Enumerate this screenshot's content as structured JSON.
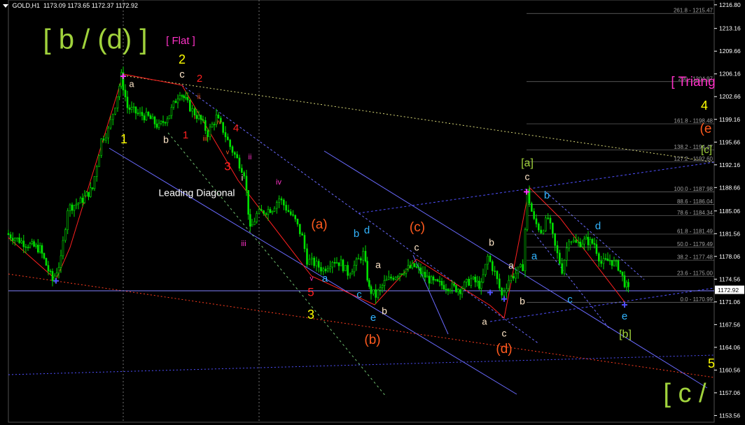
{
  "header": {
    "symbol": "GOLD,H1",
    "ohlc": "1173.09 1173.65 1172.37 1172.92"
  },
  "colors": {
    "background": "#000000",
    "candle": "#00e000",
    "axis": "#ffffff",
    "grid": "#707070",
    "fib": "#a0a0a0",
    "blue_line": "#3c3cff",
    "red_line": "#ff2020",
    "orange_label": "#ff5a1e",
    "yellow_label": "#ffff00",
    "green_label": "#a0d23c",
    "cyan_label": "#32b4ff",
    "magenta_label": "#ff32c8",
    "white_label": "#ffe6c8"
  },
  "chart_data": {
    "type": "candlestick",
    "symbol": "GOLD",
    "timeframe": "H1",
    "ylim": [
      1153.5,
      1217.0
    ],
    "y_ticks": [
      "1216.80",
      "1213.16",
      "1209.66",
      "1206.16",
      "1202.66",
      "1199.16",
      "1195.66",
      "1192.16",
      "1188.66",
      "1185.06",
      "1181.56",
      "1178.06",
      "1174.56",
      "1171.06",
      "1167.56",
      "1164.06",
      "1160.56",
      "1157.06",
      "1153.56"
    ],
    "current_price": "1172.92",
    "fib_levels": [
      {
        "label": "261.8 - 1215.47",
        "value": 1215.47
      },
      {
        "label": "200 - 1204.97",
        "value": 1204.97
      },
      {
        "label": "161.8 - 1198.48",
        "value": 1198.48
      },
      {
        "label": "138.2 - 1194.47",
        "value": 1194.47
      },
      {
        "label": "127.2 - 1192.60",
        "value": 1192.6
      },
      {
        "label": "100.0 - 1187.98",
        "value": 1187.98
      },
      {
        "label": "88.6 - 1186.04",
        "value": 1186.04
      },
      {
        "label": "78.6 - 1184.34",
        "value": 1184.34
      },
      {
        "label": "61.8 - 1181.49",
        "value": 1181.49
      },
      {
        "label": "50.0 - 1179.49",
        "value": 1179.49
      },
      {
        "label": "38.2 - 1177.48",
        "value": 1177.48
      },
      {
        "label": "23.6 - 1175.00",
        "value": 1175.0
      },
      {
        "label": "0.0 - 1170.99",
        "value": 1170.99
      }
    ],
    "price_path": [
      [
        12,
        1181.6
      ],
      [
        40,
        1180.0
      ],
      [
        60,
        1179.2
      ],
      [
        78,
        1174.3
      ],
      [
        90,
        1177.5
      ],
      [
        100,
        1185.5
      ],
      [
        118,
        1186.5
      ],
      [
        135,
        1188.5
      ],
      [
        148,
        1196.0
      ],
      [
        158,
        1197.5
      ],
      [
        168,
        1201.5
      ],
      [
        176,
        1205.8
      ],
      [
        185,
        1201.0
      ],
      [
        200,
        1200.0
      ],
      [
        215,
        1199.5
      ],
      [
        230,
        1198.0
      ],
      [
        245,
        1200.0
      ],
      [
        260,
        1203.5
      ],
      [
        268,
        1202.0
      ],
      [
        278,
        1200.5
      ],
      [
        290,
        1199.0
      ],
      [
        300,
        1197.0
      ],
      [
        312,
        1199.5
      ],
      [
        322,
        1197.5
      ],
      [
        332,
        1195.0
      ],
      [
        342,
        1193.0
      ],
      [
        352,
        1191.0
      ],
      [
        360,
        1182.0
      ],
      [
        370,
        1184.5
      ],
      [
        380,
        1185.0
      ],
      [
        392,
        1185.5
      ],
      [
        402,
        1187.0
      ],
      [
        412,
        1185.5
      ],
      [
        425,
        1183.5
      ],
      [
        435,
        1181.0
      ],
      [
        442,
        1177.5
      ],
      [
        452,
        1177.0
      ],
      [
        465,
        1176.0
      ],
      [
        478,
        1177.5
      ],
      [
        490,
        1177.0
      ],
      [
        500,
        1175.5
      ],
      [
        512,
        1177.0
      ],
      [
        522,
        1178.5
      ],
      [
        530,
        1173.0
      ],
      [
        540,
        1172.0
      ],
      [
        552,
        1174.0
      ],
      [
        565,
        1175.0
      ],
      [
        580,
        1176.0
      ],
      [
        595,
        1176.5
      ],
      [
        610,
        1175.0
      ],
      [
        622,
        1174.0
      ],
      [
        640,
        1173.5
      ],
      [
        660,
        1173.0
      ],
      [
        676,
        1174.5
      ],
      [
        690,
        1173.5
      ],
      [
        700,
        1178.0
      ],
      [
        710,
        1175.5
      ],
      [
        720,
        1172.0
      ],
      [
        730,
        1174.5
      ],
      [
        740,
        1175.5
      ],
      [
        750,
        1176.5
      ],
      [
        756,
        1188.0
      ],
      [
        766,
        1183.5
      ],
      [
        776,
        1182.0
      ],
      [
        786,
        1184.0
      ],
      [
        796,
        1179.5
      ],
      [
        806,
        1176.0
      ],
      [
        816,
        1181.0
      ],
      [
        826,
        1180.0
      ],
      [
        840,
        1180.5
      ],
      [
        852,
        1180.0
      ],
      [
        862,
        1177.0
      ],
      [
        874,
        1177.5
      ],
      [
        886,
        1176.5
      ],
      [
        895,
        1174.0
      ],
      [
        900,
        1172.8
      ]
    ],
    "wave_labels": [
      {
        "text": "[ b / (d) ]",
        "color": "green_label",
        "size": 40,
        "x": 136,
        "y": 59
      },
      {
        "text": "[ Flat ]",
        "color": "magenta_label",
        "size": 15,
        "x": 258,
        "y": 59
      },
      {
        "text": "2",
        "color": "yellow_label",
        "size": 18,
        "x": 260,
        "y": 86
      },
      {
        "text": "c",
        "color": "white_label",
        "size": 15,
        "x": 260,
        "y": 107
      },
      {
        "text": "2",
        "color": "red_line",
        "size": 15,
        "x": 285,
        "y": 113
      },
      {
        "text": "a",
        "color": "white_label",
        "size": 13,
        "x": 188,
        "y": 121
      },
      {
        "text": "ii",
        "color": "orange_label",
        "size": 10,
        "x": 284,
        "y": 139
      },
      {
        "text": "iv",
        "color": "orange_label",
        "size": 9,
        "x": 313,
        "y": 175
      },
      {
        "text": "i",
        "color": "orange_label",
        "size": 9,
        "x": 278,
        "y": 168
      },
      {
        "text": "4",
        "color": "red_line",
        "size": 15,
        "x": 337,
        "y": 184
      },
      {
        "text": "1",
        "color": "yellow_label",
        "size": 18,
        "x": 177,
        "y": 200
      },
      {
        "text": "b",
        "color": "white_label",
        "size": 14,
        "x": 237,
        "y": 201
      },
      {
        "text": "1",
        "color": "red_line",
        "size": 15,
        "x": 265,
        "y": 194
      },
      {
        "text": "iii",
        "color": "orange_label",
        "size": 10,
        "x": 293,
        "y": 199
      },
      {
        "text": "v",
        "color": "orange_label",
        "size": 9,
        "x": 325,
        "y": 218
      },
      {
        "text": "ii",
        "color": "magenta_label",
        "size": 11,
        "x": 357,
        "y": 225
      },
      {
        "text": "3",
        "color": "red_line",
        "size": 17,
        "x": 325,
        "y": 239
      },
      {
        "text": "i",
        "color": "white_label",
        "size": 13,
        "x": 346,
        "y": 255
      },
      {
        "text": "iv",
        "color": "magenta_label",
        "size": 11,
        "x": 398,
        "y": 261
      },
      {
        "text": "Leading Diagonal",
        "color": "axis",
        "size": 14,
        "x": 281,
        "y": 277
      },
      {
        "text": "(a)",
        "color": "orange_label",
        "size": 19,
        "x": 456,
        "y": 322
      },
      {
        "text": "b",
        "color": "cyan_label",
        "size": 15,
        "x": 509,
        "y": 335
      },
      {
        "text": "d",
        "color": "cyan_label",
        "size": 15,
        "x": 524,
        "y": 330
      },
      {
        "text": "(c)",
        "color": "orange_label",
        "size": 19,
        "x": 596,
        "y": 326
      },
      {
        "text": "iii",
        "color": "magenta_label",
        "size": 11,
        "x": 348,
        "y": 349
      },
      {
        "text": "c",
        "color": "white_label",
        "size": 14,
        "x": 595,
        "y": 355
      },
      {
        "text": "b",
        "color": "white_label",
        "size": 14,
        "x": 702,
        "y": 348
      },
      {
        "text": "a",
        "color": "white_label",
        "size": 14,
        "x": 540,
        "y": 380
      },
      {
        "text": "a",
        "color": "white_label",
        "size": 14,
        "x": 730,
        "y": 381
      },
      {
        "text": "a",
        "color": "cyan_label",
        "size": 15,
        "x": 464,
        "y": 399
      },
      {
        "text": "v",
        "color": "magenta_label",
        "size": 10,
        "x": 445,
        "y": 399
      },
      {
        "text": "5",
        "color": "red_line",
        "size": 17,
        "x": 444,
        "y": 419
      },
      {
        "text": "c",
        "color": "cyan_label",
        "size": 15,
        "x": 513,
        "y": 422
      },
      {
        "text": "b",
        "color": "white_label",
        "size": 14,
        "x": 549,
        "y": 446
      },
      {
        "text": "e",
        "color": "cyan_label",
        "size": 15,
        "x": 533,
        "y": 455
      },
      {
        "text": "3",
        "color": "yellow_label",
        "size": 18,
        "x": 444,
        "y": 451
      },
      {
        "text": "(b)",
        "color": "orange_label",
        "size": 19,
        "x": 532,
        "y": 487
      },
      {
        "text": "a",
        "color": "white_label",
        "size": 13,
        "x": 692,
        "y": 461
      },
      {
        "text": "c",
        "color": "white_label",
        "size": 14,
        "x": 720,
        "y": 478
      },
      {
        "text": "(d)",
        "color": "orange_label",
        "size": 19,
        "x": 720,
        "y": 500
      },
      {
        "text": "b",
        "color": "white_label",
        "size": 14,
        "x": 746,
        "y": 432
      },
      {
        "text": "[a]",
        "color": "green_label",
        "size": 16,
        "x": 753,
        "y": 234
      },
      {
        "text": "c",
        "color": "white_label",
        "size": 14,
        "x": 753,
        "y": 254
      },
      {
        "text": "b",
        "color": "cyan_label",
        "size": 15,
        "x": 781,
        "y": 280
      },
      {
        "text": "d",
        "color": "cyan_label",
        "size": 15,
        "x": 854,
        "y": 324
      },
      {
        "text": "a",
        "color": "cyan_label",
        "size": 15,
        "x": 763,
        "y": 367
      },
      {
        "text": "c",
        "color": "cyan_label",
        "size": 15,
        "x": 814,
        "y": 429
      },
      {
        "text": "e",
        "color": "cyan_label",
        "size": 15,
        "x": 892,
        "y": 453
      },
      {
        "text": "[b]",
        "color": "green_label",
        "size": 16,
        "x": 893,
        "y": 479
      },
      {
        "text": "[ Triang",
        "color": "magenta_label",
        "size": 19,
        "x": 990,
        "y": 118
      },
      {
        "text": "4",
        "color": "yellow_label",
        "size": 18,
        "x": 1006,
        "y": 152
      },
      {
        "text": "(e",
        "color": "orange_label",
        "size": 19,
        "x": 1008,
        "y": 185
      },
      {
        "text": "[c]",
        "color": "green_label",
        "size": 15,
        "x": 1009,
        "y": 215
      },
      {
        "text": "5",
        "color": "yellow_label",
        "size": 18,
        "x": 1016,
        "y": 521
      },
      {
        "text": "[ c /",
        "color": "green_label",
        "size": 38,
        "x": 978,
        "y": 565
      }
    ]
  }
}
